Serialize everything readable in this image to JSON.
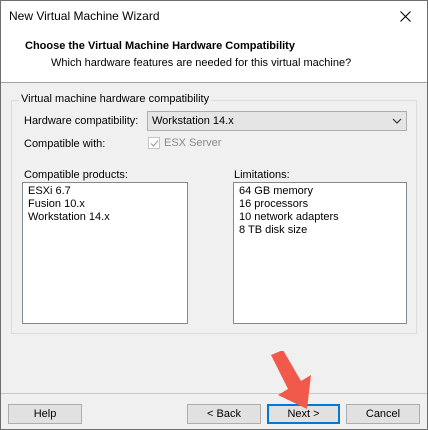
{
  "window": {
    "title": "New Virtual Machine Wizard"
  },
  "header": {
    "title": "Choose the Virtual Machine Hardware Compatibility",
    "subtitle": "Which hardware features are needed for this virtual machine?"
  },
  "group": {
    "legend": "Virtual machine hardware compatibility",
    "hardware_label": "Hardware compatibility:",
    "hardware_value": "Workstation 14.x",
    "compatible_label": "Compatible with:",
    "esx_label": "ESX Server",
    "esx_checked": true,
    "products_label": "Compatible products:",
    "products": [
      "ESXi 6.7",
      "Fusion 10.x",
      "Workstation 14.x"
    ],
    "limitations_label": "Limitations:",
    "limitations": [
      "64 GB memory",
      "16 processors",
      "10 network adapters",
      "8 TB disk size"
    ]
  },
  "buttons": {
    "help": "Help",
    "back": "< Back",
    "next": "Next >",
    "cancel": "Cancel"
  },
  "colors": {
    "arrow": "#f15a4a",
    "default_button_border": "#0078d7"
  },
  "icons": {
    "close": "close-icon",
    "dropdown": "chevron-down-icon",
    "annotation": "red-pointer-arrow"
  }
}
